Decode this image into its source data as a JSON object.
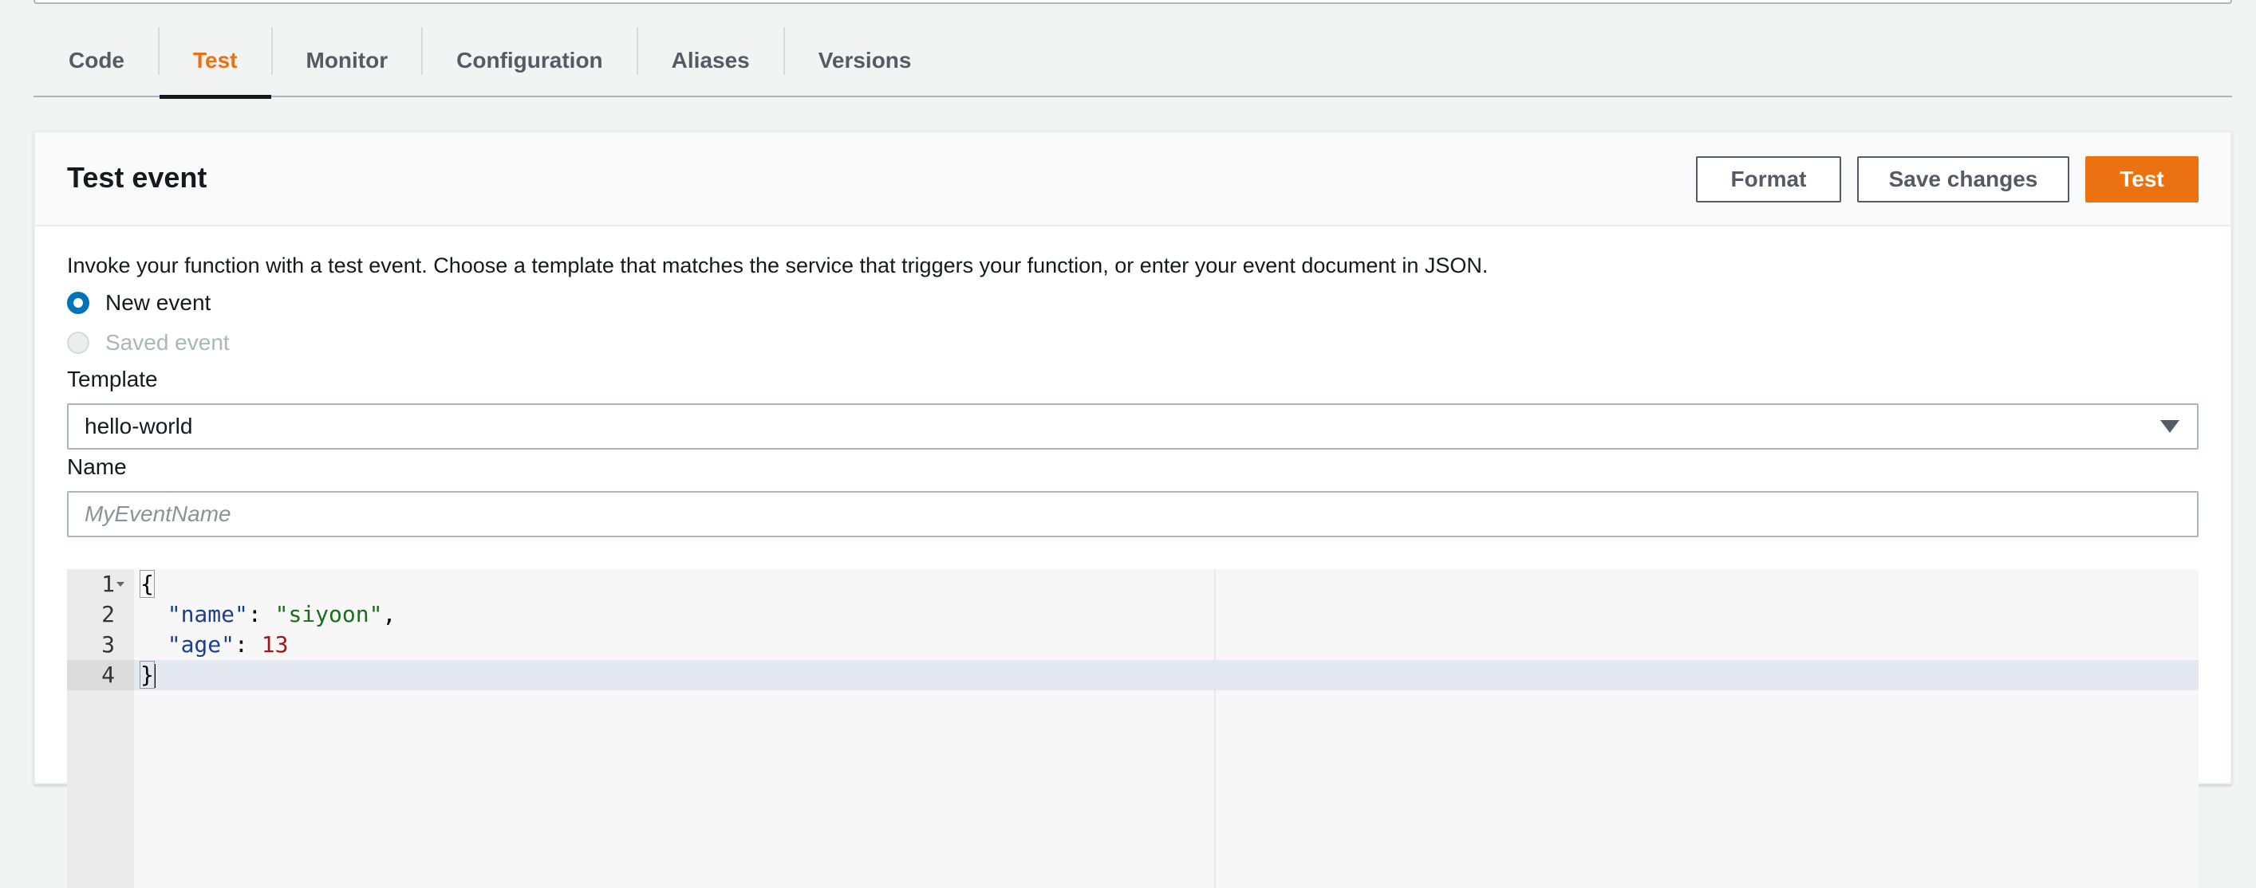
{
  "tabs": [
    {
      "label": "Code",
      "active": false
    },
    {
      "label": "Test",
      "active": true
    },
    {
      "label": "Monitor",
      "active": false
    },
    {
      "label": "Configuration",
      "active": false
    },
    {
      "label": "Aliases",
      "active": false
    },
    {
      "label": "Versions",
      "active": false
    }
  ],
  "panel": {
    "title": "Test event",
    "buttons": {
      "format": "Format",
      "save": "Save changes",
      "test": "Test"
    },
    "description": "Invoke your function with a test event. Choose a template that matches the service that triggers your function, or enter your event document in JSON.",
    "radios": {
      "new_event": "New event",
      "saved_event": "Saved event",
      "selected": "new_event"
    },
    "template": {
      "label": "Template",
      "value": "hello-world"
    },
    "name": {
      "label": "Name",
      "placeholder": "MyEventName",
      "value": ""
    }
  },
  "editor": {
    "line_numbers": [
      "1",
      "2",
      "3",
      "4"
    ],
    "active_line": 4,
    "tokens": {
      "open_brace": "{",
      "key_name": "\"name\"",
      "value_name": "\"siyoon\"",
      "key_age": "\"age\"",
      "value_age": "13",
      "close_brace": "}",
      "colon": ": ",
      "comma": ","
    }
  },
  "colors": {
    "accent": "#ec7211",
    "radio_selected": "#0073bb",
    "text": "#16191f",
    "muted": "#545b64"
  }
}
